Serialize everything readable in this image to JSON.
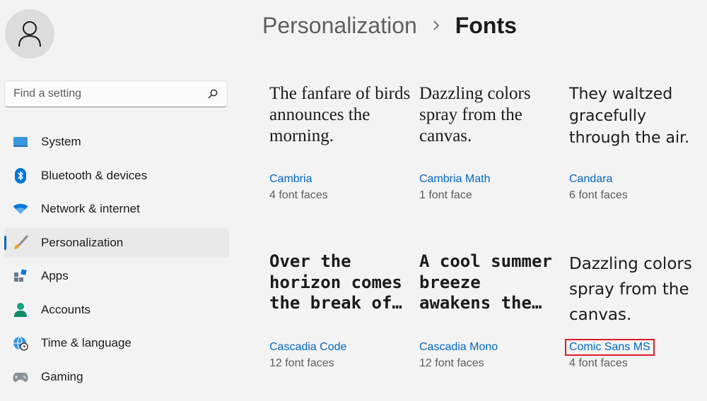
{
  "search": {
    "placeholder": "Find a setting"
  },
  "nav": [
    {
      "label": "System",
      "icon": "system-icon"
    },
    {
      "label": "Bluetooth & devices",
      "icon": "bluetooth-icon"
    },
    {
      "label": "Network & internet",
      "icon": "wifi-icon"
    },
    {
      "label": "Personalization",
      "icon": "brush-icon",
      "active": true
    },
    {
      "label": "Apps",
      "icon": "apps-icon"
    },
    {
      "label": "Accounts",
      "icon": "accounts-icon"
    },
    {
      "label": "Time & language",
      "icon": "globe-clock-icon"
    },
    {
      "label": "Gaming",
      "icon": "gamepad-icon"
    }
  ],
  "breadcrumb": {
    "parent": "Personalization",
    "current": "Fonts"
  },
  "fonts": [
    {
      "sample": "The fanfare of birds announces the morning.",
      "name": "Cambria",
      "faces": "4 font faces"
    },
    {
      "sample": "Dazzling colors spray from the canvas.",
      "name": "Cambria Math",
      "faces": "1 font face"
    },
    {
      "sample": "They waltzed gracefully through the air.",
      "name": "Candara",
      "faces": "6 font faces"
    },
    {
      "sample": "Over the horizon comes the break of…",
      "name": "Cascadia Code",
      "faces": "12 font faces"
    },
    {
      "sample": "A cool summer breeze awakens the…",
      "name": "Cascadia Mono",
      "faces": "12 font faces"
    },
    {
      "sample": "Dazzling colors spray from the canvas.",
      "name": "Comic Sans MS",
      "faces": "4 font faces"
    }
  ],
  "colors": {
    "accent": "#0067c0",
    "highlight_box": "#e01b24"
  }
}
